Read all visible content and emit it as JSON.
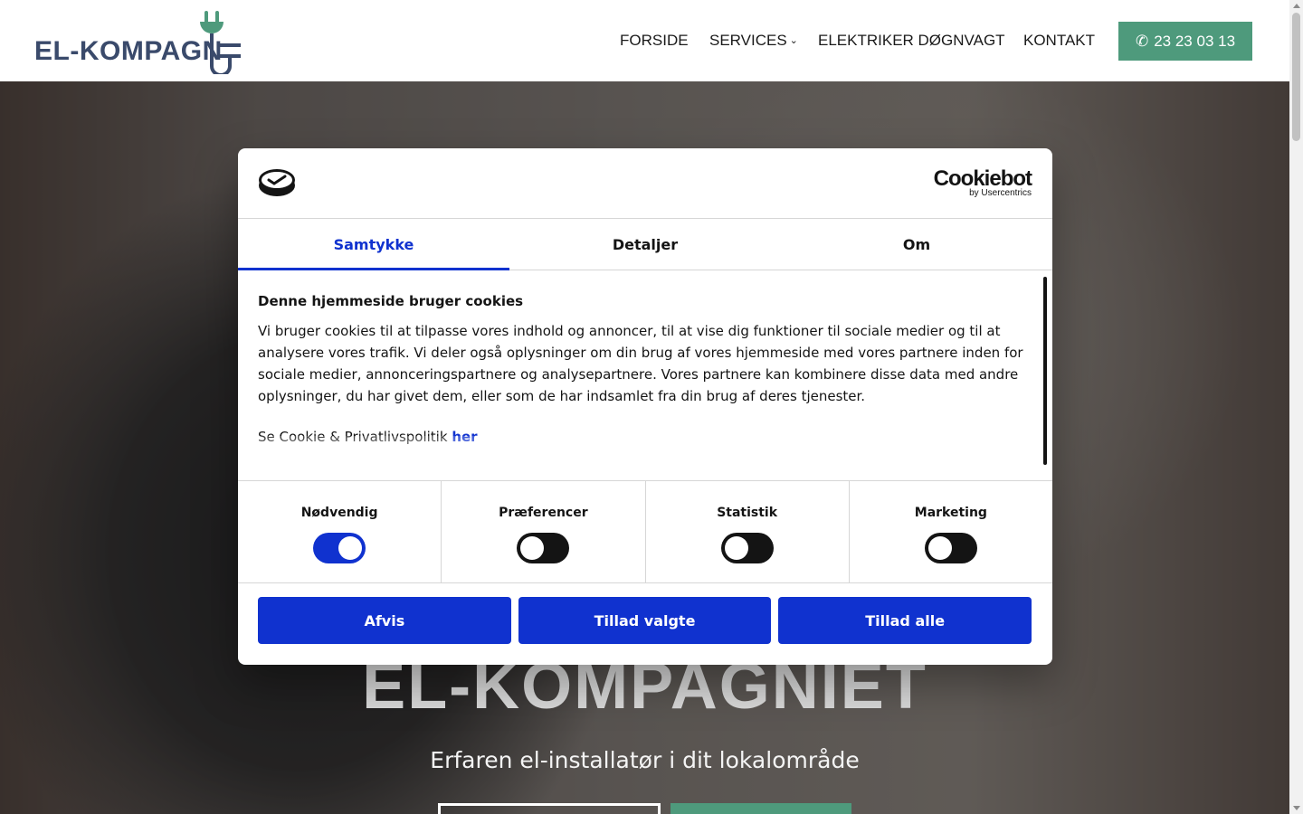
{
  "header": {
    "logo_text": "EL-KOMPAGN",
    "nav": [
      {
        "label": "FORSIDE"
      },
      {
        "label": "SERVICES"
      },
      {
        "label": "ELEKTRIKER DØGNVAGT"
      },
      {
        "label": "KONTAKT"
      }
    ],
    "phone": "23 23 03 13"
  },
  "hero": {
    "title": "EL-KOMPAGNIET",
    "subtitle": "Erfaren el-installatør i dit lokalområde"
  },
  "cookie_dialog": {
    "brand": {
      "word": "Cookiebot",
      "by": "by Usercentrics"
    },
    "tabs": [
      {
        "label": "Samtykke",
        "active": true
      },
      {
        "label": "Detaljer",
        "active": false
      },
      {
        "label": "Om",
        "active": false
      }
    ],
    "heading": "Denne hjemmeside bruger cookies",
    "text": "Vi bruger cookies til at tilpasse vores indhold og annoncer, til at vise dig funktioner til sociale medier og til at analysere vores trafik. Vi deler også oplysninger om din brug af vores hjemmeside med vores partnere inden for sociale medier, annonceringspartnere og analysepartnere. Vores partnere kan kombinere disse data med andre oplysninger, du har givet dem, eller som de har indsamlet fra din brug af deres tjenester.",
    "policy_text": "Se Cookie & Privatlivspolitik",
    "policy_link": "her",
    "toggles": [
      {
        "label": "Nødvendig",
        "on": true
      },
      {
        "label": "Præferencer",
        "on": false
      },
      {
        "label": "Statistik",
        "on": false
      },
      {
        "label": "Marketing",
        "on": false
      }
    ],
    "buttons": {
      "reject": "Afvis",
      "allow_selected": "Tillad valgte",
      "allow_all": "Tillad alle"
    },
    "accent_color": "#1032cf"
  },
  "colors": {
    "brand_green": "#4e9a7c",
    "logo_navy": "#3a4a6b"
  }
}
